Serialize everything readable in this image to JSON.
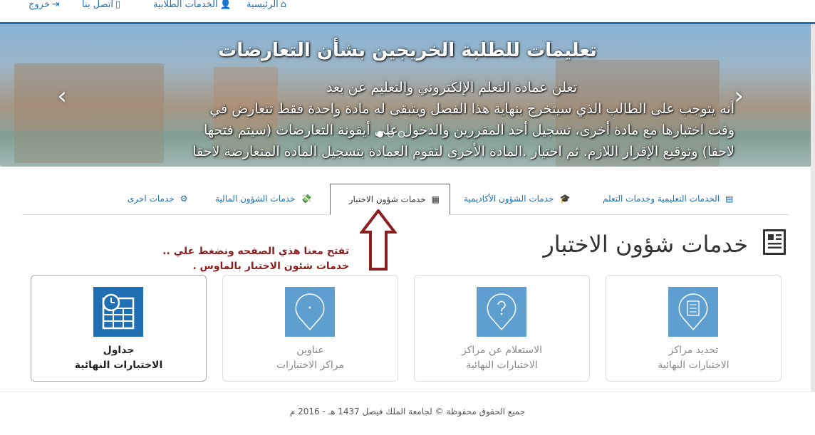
{
  "topnav": {
    "items": [
      {
        "label": "الرئيسية",
        "icon": "home-icon"
      },
      {
        "label": "الخدمات الطلابية",
        "icon": "user-icon"
      },
      {
        "label": "اتصل بنا",
        "icon": "phone-icon"
      },
      {
        "label": "خروج",
        "icon": "logout-icon"
      }
    ]
  },
  "slider": {
    "title": "تعليمات للطلبة الخريجين بشأن التعارضات",
    "lines": [
      "تعلن عمادة التعلم الإلكتروني والتعليم عن بعد",
      "أنه يتوجب على الطالب الذي سيتخرج بنهاية هذا الفصل ويتبقى له مادة واحدة فقط تتعارض في",
      "وقت اختبارها مع مادة أخرى، تسجيل أحد المقررين والدخول على أيقونة التعارضات (سيتم فتحها",
      "لاحقا) وتوقيع الإقرار اللازم. ثم اختيار .المادة الأخرى لتقوم العمادة بتسجيل المادة المتعارضة لاحقا"
    ],
    "prev_symbol": "‹",
    "next_symbol": "›",
    "active_slide": 1,
    "slide_count": 3
  },
  "tabs": [
    {
      "label": "الخدمات التعليمية وخدمات التعلم",
      "icon": "clipboard-icon",
      "glyph": "▤"
    },
    {
      "label": "خدمات الشؤون الأكاديمية",
      "icon": "graduation-cap-icon",
      "glyph": "🎓"
    },
    {
      "label": "خدمات شؤون الاختبار",
      "icon": "newspaper-icon",
      "glyph": "▦",
      "active": true
    },
    {
      "label": "خدمات الشؤون المالية",
      "icon": "money-icon",
      "glyph": "💸"
    },
    {
      "label": "خدمات اخرى",
      "icon": "gear-icon",
      "glyph": "⚙"
    }
  ],
  "heading": {
    "title": "خدمات شؤون الاختبار",
    "icon": "newspaper-icon"
  },
  "annotation": {
    "line1": "تفتح معنا هذي الصفحه ونضغط علي ..",
    "line2": "خدمات شئون الاختبار بالماوس .",
    "color": "#8b1e1e"
  },
  "cards": [
    {
      "line1": "تحديد مراكز",
      "line2": "الاختبارات النهائية",
      "icon": "checklist-pin-icon"
    },
    {
      "line1": "الاستعلام عن مراكز",
      "line2": "الاختبارات النهائية",
      "icon": "question-pin-icon"
    },
    {
      "line1": "عناوين",
      "line2": "مراكز الاختبارات",
      "icon": "location-pin-icon"
    },
    {
      "line1": "جداول",
      "line2": "الاختبارات النهائية",
      "icon": "calendar-clock-icon"
    }
  ],
  "footer": {
    "text": "جميع الحقوق محفوظة © لجامعة الملك فيصل 1437 هـ - 2016 م"
  },
  "colors": {
    "primary": "#1f6fb2",
    "card_icon": "#5e9fd0",
    "card_icon_featured": "#1f6fb2"
  }
}
